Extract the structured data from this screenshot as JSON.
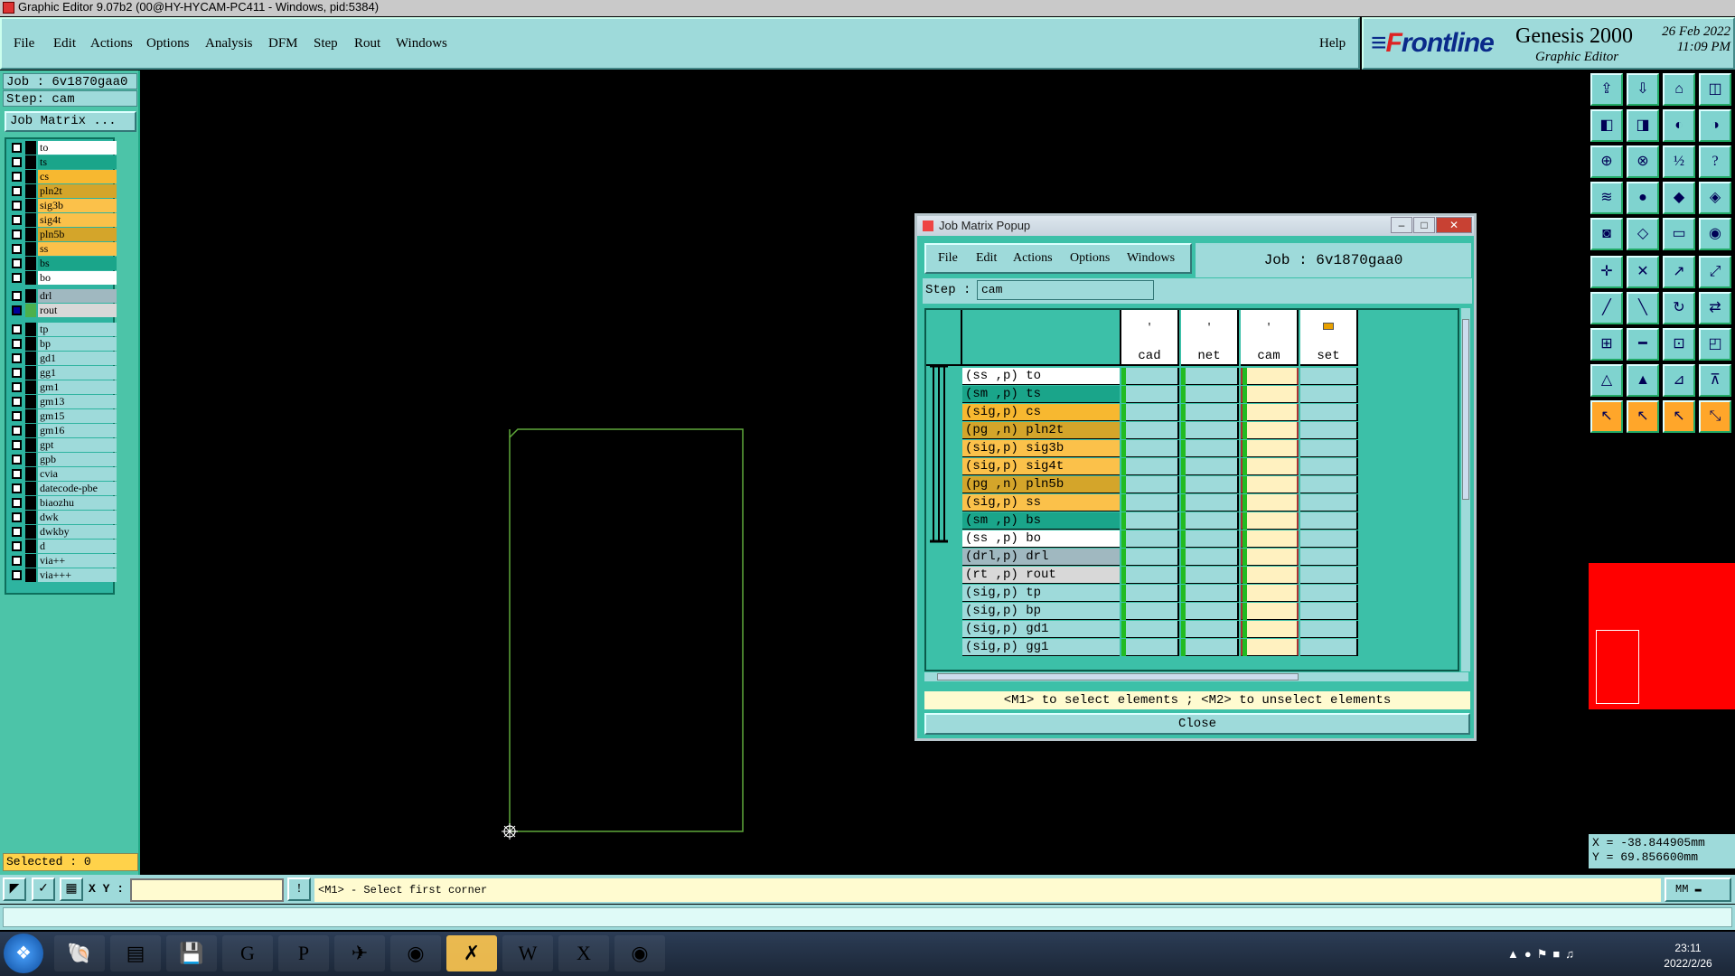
{
  "window": {
    "title": "Graphic Editor 9.07b2 (00@HY-HYCAM-PC411 - Windows, pid:5384)"
  },
  "menu": [
    "File",
    "Edit",
    "Actions",
    "Options",
    "Analysis",
    "DFM",
    "Step",
    "Rout",
    "Windows"
  ],
  "help": "Help",
  "brand": {
    "logo_prefix": "F",
    "logo_rest": "rontline",
    "product": "Genesis 2000",
    "sub": "Graphic Editor",
    "date": "26 Feb 2022",
    "time": "11:09 PM"
  },
  "left": {
    "job": "Job : 6v1870gaa0",
    "step": "Step: cam",
    "job_matrix_btn": "Job Matrix ...",
    "selected": "Selected : 0"
  },
  "layers_top": [
    {
      "name": "to",
      "color": "#ffffff"
    },
    {
      "name": "ts",
      "color": "#1aa58a"
    },
    {
      "name": "cs",
      "color": "#f7b830"
    },
    {
      "name": "pln2t",
      "color": "#d4a52a"
    },
    {
      "name": "sig3b",
      "color": "#fbc14a"
    },
    {
      "name": "sig4t",
      "color": "#fbc14a"
    },
    {
      "name": "pln5b",
      "color": "#d4a52a"
    },
    {
      "name": "ss",
      "color": "#fbc14a"
    },
    {
      "name": "bs",
      "color": "#1aa58a"
    },
    {
      "name": "bo",
      "color": "#ffffff"
    }
  ],
  "layers_drill": [
    {
      "name": "drl",
      "color": "#a0b8c0"
    },
    {
      "name": "rout",
      "color": "#d8d8d8",
      "checked": true,
      "green": true
    }
  ],
  "layers_misc": [
    "tp",
    "bp",
    "gd1",
    "gg1",
    "gm1",
    "gm13",
    "gm15",
    "gm16",
    "gpt",
    "gpb",
    "cvia",
    "datecode-pbe",
    "biaozhu",
    "dwk",
    "dwkby",
    "d",
    "via++",
    "via+++"
  ],
  "coords": {
    "x": "X = -38.844905mm",
    "y": "Y = 69.856600mm"
  },
  "cmd": {
    "xy_label": "X Y :",
    "xy_value": "",
    "prompt": "<M1> - Select first corner",
    "units": "MM"
  },
  "taskbar": {
    "time": "23:11",
    "date": "2022/2/26"
  },
  "popup": {
    "title": "Job Matrix Popup",
    "menu": [
      "File",
      "Edit",
      "Actions",
      "Options",
      "Windows"
    ],
    "job": "Job : 6v1870gaa0",
    "step_label": "Step :",
    "step_value": "cam",
    "columns": [
      "cad",
      "net",
      "cam",
      "set"
    ],
    "rows": [
      {
        "label": "(ss ,p) to",
        "color": "#ffffff"
      },
      {
        "label": "(sm ,p) ts",
        "color": "#1aa58a"
      },
      {
        "label": "(sig,p) cs",
        "color": "#f7b830"
      },
      {
        "label": "(pg ,n) pln2t",
        "color": "#d4a52a"
      },
      {
        "label": "(sig,p) sig3b",
        "color": "#fbc14a"
      },
      {
        "label": "(sig,p) sig4t",
        "color": "#fbc14a"
      },
      {
        "label": "(pg ,n) pln5b",
        "color": "#d4a52a"
      },
      {
        "label": "(sig,p) ss",
        "color": "#fbc14a"
      },
      {
        "label": "(sm ,p) bs",
        "color": "#1aa58a"
      },
      {
        "label": "(ss ,p) bo",
        "color": "#ffffff"
      },
      {
        "label": "(drl,p) drl",
        "color": "#a0b8c0"
      },
      {
        "label": "(rt ,p) rout",
        "color": "#d8d8d8"
      },
      {
        "label": "(sig,p) tp",
        "color": "#9edada"
      },
      {
        "label": "(sig,p) bp",
        "color": "#9edada"
      },
      {
        "label": "(sig,p) gd1",
        "color": "#9edada"
      },
      {
        "label": "(sig,p) gg1",
        "color": "#9edada"
      }
    ],
    "instruction": "<M1> to select elements ; <M2> to unselect elements",
    "close": "Close"
  }
}
